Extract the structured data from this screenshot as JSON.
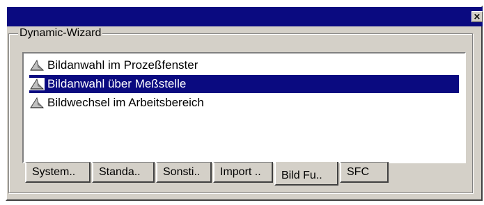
{
  "window": {
    "close_label": "×",
    "titlebar_color": "#0a0a80",
    "face_color": "#d4d0c8"
  },
  "group": {
    "label": "Dynamic-Wizard"
  },
  "list": {
    "items": [
      {
        "label": "Bildanwahl im Prozeßfenster",
        "selected": false,
        "icon": "wizard-icon"
      },
      {
        "label": "Bildanwahl über Meßstelle",
        "selected": true,
        "icon": "wizard-icon"
      },
      {
        "label": "Bildwechsel im Arbeitsbereich",
        "selected": false,
        "icon": "wizard-icon"
      }
    ],
    "selection_color": "#0a0a80"
  },
  "tabs": [
    {
      "label": "System..",
      "active": false
    },
    {
      "label": "Standa..",
      "active": false
    },
    {
      "label": "Sonsti..",
      "active": false
    },
    {
      "label": "Import ..",
      "active": false
    },
    {
      "label": "Bild Fu..",
      "active": true
    },
    {
      "label": "SFC",
      "active": false
    }
  ]
}
